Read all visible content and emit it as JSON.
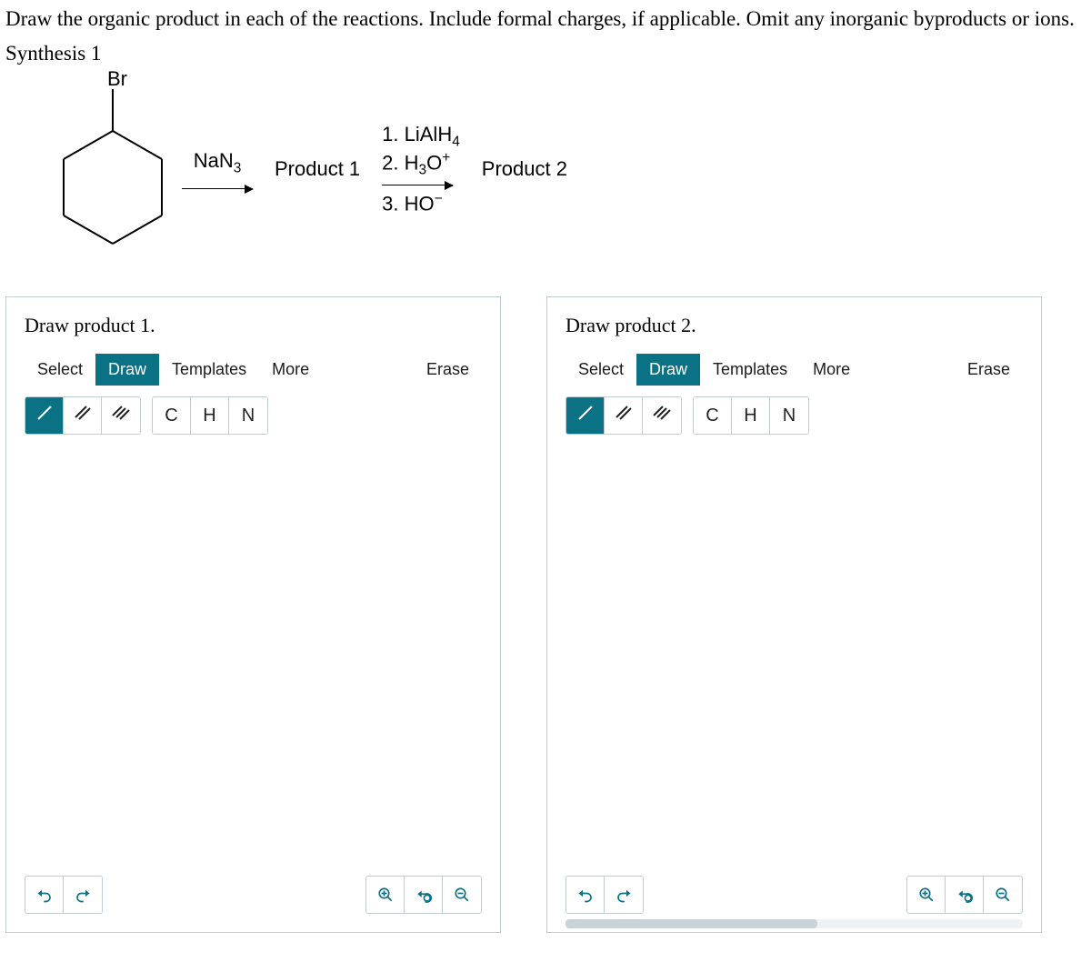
{
  "question": "Draw the organic product in each of the reactions. Include formal charges, if applicable. Omit any inorganic byproducts or ions.",
  "synthesis_label": "Synthesis 1",
  "molecule_label": "Br",
  "step1": {
    "reagent_html": "NaN<sub>3</sub>",
    "product_label": "Product 1"
  },
  "step2": {
    "line1_html": "1. LiAlH<sub>4</sub>",
    "line2_html": "2. H<sub>3</sub>O<sup>+</sup>",
    "line3_html": "3. HO<sup>&minus;</sup>",
    "product_label": "Product 2"
  },
  "panel1": {
    "title": "Draw product 1.",
    "tabs": [
      "Select",
      "Draw",
      "Templates",
      "More"
    ],
    "active_tab": 1,
    "erase": "Erase",
    "bonds_active": 0,
    "elements": [
      "C",
      "H",
      "N"
    ]
  },
  "panel2": {
    "title": "Draw product 2.",
    "tabs": [
      "Select",
      "Draw",
      "Templates",
      "More"
    ],
    "active_tab": 1,
    "erase": "Erase",
    "bonds_active": 0,
    "elements": [
      "C",
      "H",
      "N"
    ]
  }
}
